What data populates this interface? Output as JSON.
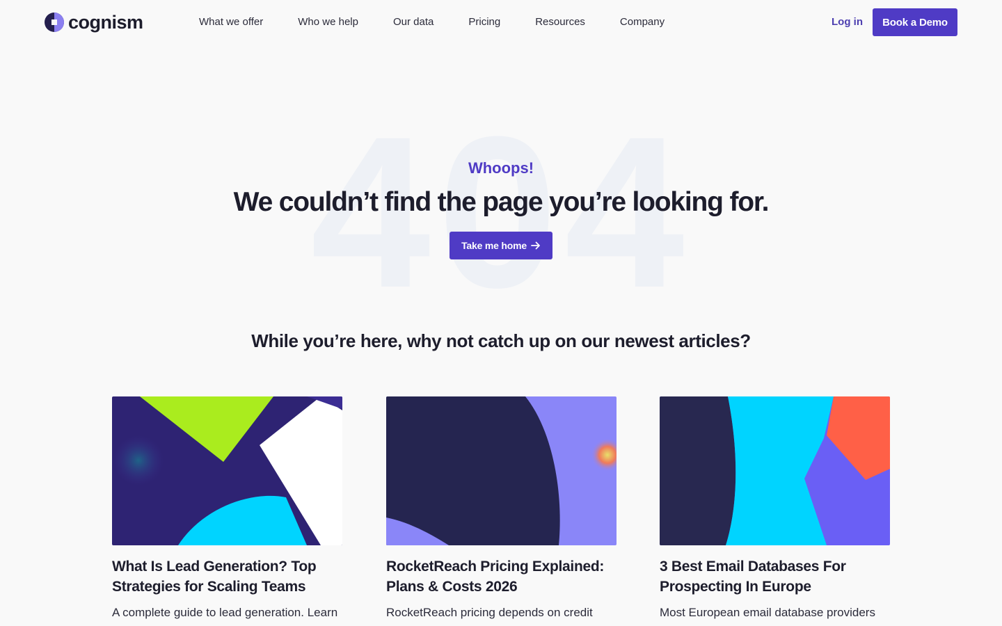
{
  "brand": {
    "name": "cognism",
    "accent": "#4f3bc5"
  },
  "nav": {
    "items": [
      {
        "label": "What we offer"
      },
      {
        "label": "Who we help"
      },
      {
        "label": "Our data"
      },
      {
        "label": "Pricing"
      },
      {
        "label": "Resources"
      },
      {
        "label": "Company"
      }
    ],
    "login": "Log in",
    "demo": "Book a Demo"
  },
  "hero": {
    "bg_text": "404",
    "eyebrow": "Whoops!",
    "title": "We couldn’t find the page you’re looking for.",
    "button": "Take me home",
    "button_icon": "arrow-right-icon"
  },
  "articles_section": {
    "title": "While you’re here, why not catch up on our newest articles?",
    "cards": [
      {
        "title": "What Is Lead Generation? Top Strategies for Scaling Teams",
        "desc": "A complete guide to lead generation. Learn the"
      },
      {
        "title": "RocketReach Pricing Explained: Plans & Costs 2026",
        "desc": "RocketReach pricing depends on credit usage, feature and capabilities and"
      },
      {
        "title": "3 Best Email Databases For Prospecting In Europe",
        "desc": "Most European email database providers weren't built specifically for"
      }
    ]
  }
}
